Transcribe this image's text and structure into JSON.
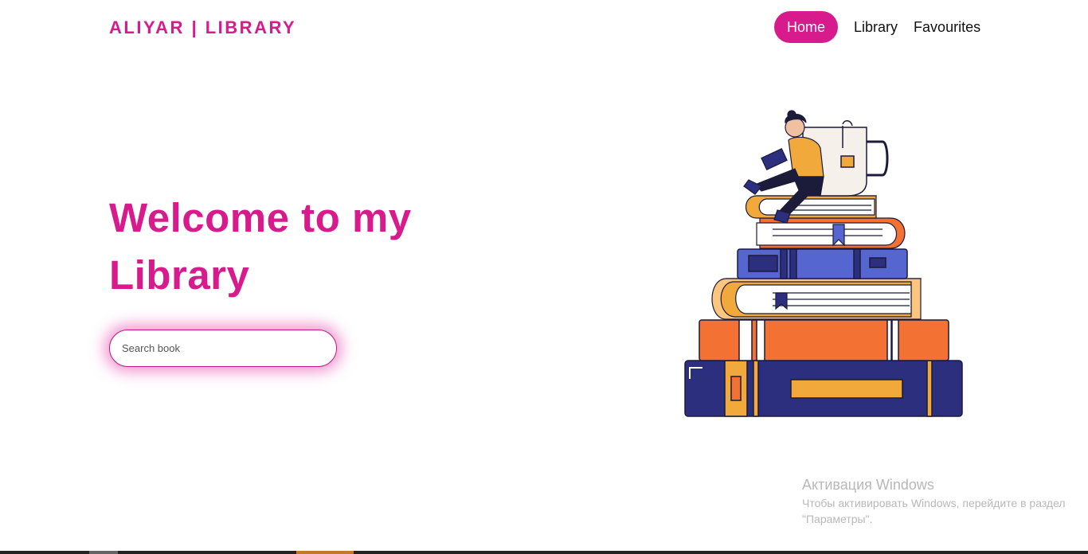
{
  "header": {
    "logo": "ALIYAR | LIBRARY",
    "nav": [
      {
        "label": "Home",
        "active": true
      },
      {
        "label": "Library",
        "active": false
      },
      {
        "label": "Favourites",
        "active": false
      }
    ]
  },
  "hero": {
    "title": "Welcome to my Library",
    "search_placeholder": "Search book"
  },
  "illustration": {
    "icon": "stack-of-books-reader-illustration"
  },
  "windows_activation": {
    "title": "Активация Windows",
    "text": "Чтобы активировать Windows, перейдите в раздел \"Параметры\"."
  },
  "colors": {
    "accent": "#d81b8c",
    "navy": "#2b2f7e",
    "orange": "#f37133",
    "blue": "#5566d0",
    "cream": "#fcc67e",
    "mustard": "#f0a93a"
  }
}
